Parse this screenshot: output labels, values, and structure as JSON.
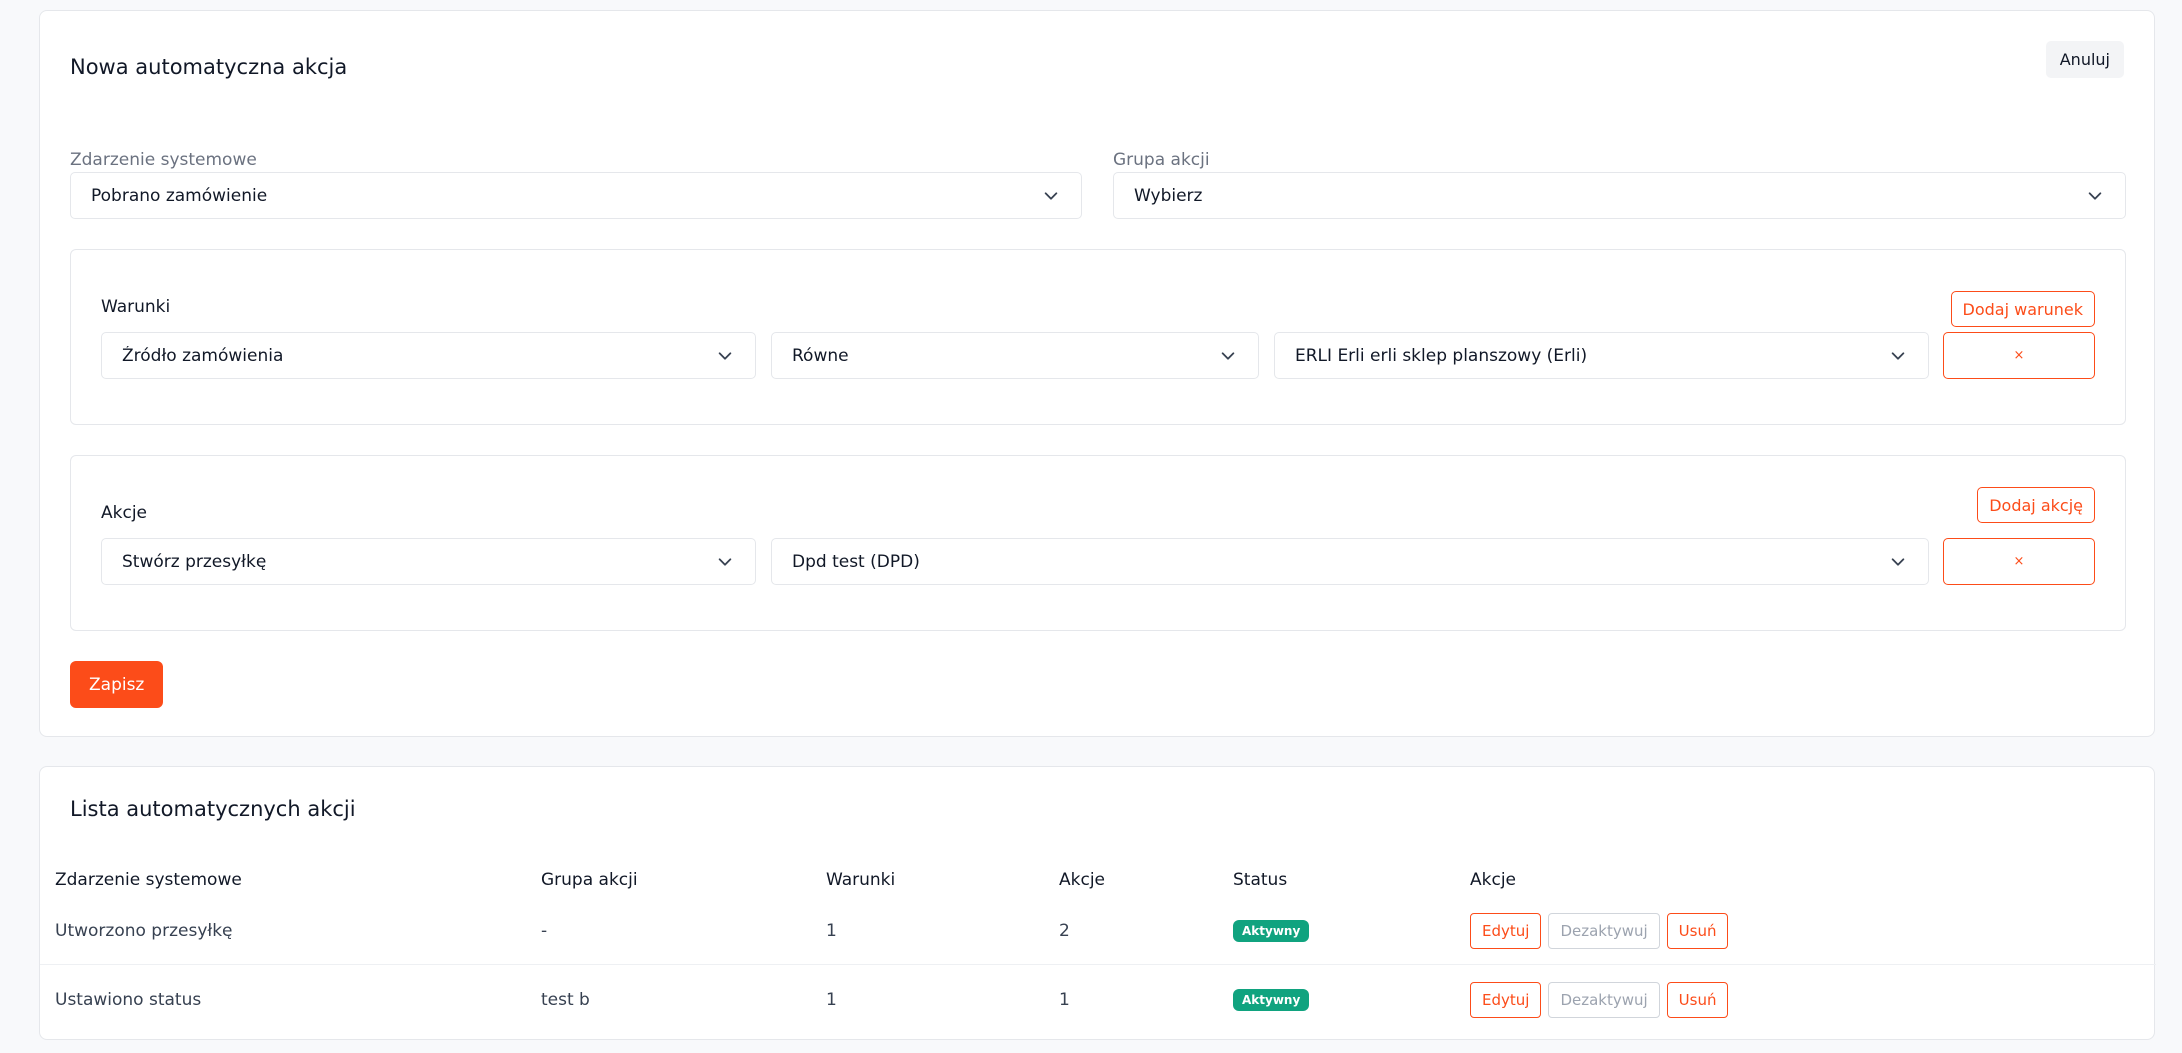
{
  "form": {
    "title": "Nowa automatyczna akcja",
    "cancel_label": "Anuluj",
    "system_event": {
      "label": "Zdarzenie systemowe",
      "value": "Pobrano zamówienie"
    },
    "action_group": {
      "label": "Grupa akcji",
      "value": "Wybierz"
    },
    "conditions": {
      "title": "Warunki",
      "add_label": "Dodaj warunek",
      "field": "Źródło zamówienia",
      "operator": "Równe",
      "value": "ERLI Erli erli sklep planszowy (Erli)",
      "remove_label": "×"
    },
    "actions": {
      "title": "Akcje",
      "add_label": "Dodaj akcję",
      "type": "Stwórz przesyłkę",
      "target": "Dpd test (DPD)",
      "remove_label": "×"
    },
    "save_label": "Zapisz"
  },
  "list": {
    "title": "Lista automatycznych akcji",
    "columns": [
      "Zdarzenie systemowe",
      "Grupa akcji",
      "Warunki",
      "Akcje",
      "Status",
      "Akcje"
    ],
    "rows": [
      {
        "event": "Utworzono przesyłkę",
        "group": "-",
        "conditions": "1",
        "actions": "2",
        "status": "Aktywny"
      },
      {
        "event": "Ustawiono status",
        "group": "test b",
        "conditions": "1",
        "actions": "1",
        "status": "Aktywny"
      }
    ],
    "row_actions": {
      "edit": "Edytuj",
      "deactivate": "Dezaktywuj",
      "delete": "Usuń"
    }
  },
  "colors": {
    "accent": "#fc4c19",
    "success": "#10a37f",
    "border": "#e5e7eb"
  }
}
